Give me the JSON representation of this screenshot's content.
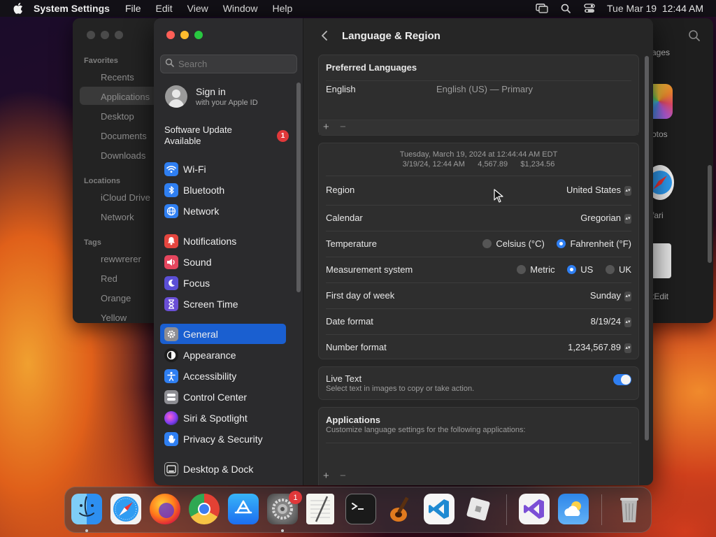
{
  "menubar": {
    "app_name": "System Settings",
    "items": [
      "File",
      "Edit",
      "View",
      "Window",
      "Help"
    ],
    "clock": "Tue Mar 19  12:44 AM"
  },
  "finder": {
    "favorites_header": "Favorites",
    "favorites": [
      "Recents",
      "Applications",
      "Desktop",
      "Documents",
      "Downloads"
    ],
    "locations_header": "Locations",
    "locations": [
      "iCloud Drive",
      "Network"
    ],
    "tags_header": "Tags",
    "tags": [
      "rewwrerer",
      "Red",
      "Orange",
      "Yellow"
    ],
    "partial_labels": [
      "ages",
      "otos",
      "fari",
      "tEdit"
    ]
  },
  "sidebar": {
    "search_placeholder": "Search",
    "signin_title": "Sign in",
    "signin_subtitle": "with your Apple ID",
    "update_label": "Software Update Available",
    "update_count": "1",
    "items": [
      {
        "label": "Wi-Fi",
        "icon": "wifi-icon",
        "color": "#2f7ff2"
      },
      {
        "label": "Bluetooth",
        "icon": "bluetooth-icon",
        "color": "#2f7ff2"
      },
      {
        "label": "Network",
        "icon": "globe-icon",
        "color": "#2f7ff2"
      },
      {
        "label": "Notifications",
        "icon": "bell-icon",
        "color": "#e5463f"
      },
      {
        "label": "Sound",
        "icon": "speaker-icon",
        "color": "#e5465e"
      },
      {
        "label": "Focus",
        "icon": "moon-icon",
        "color": "#5b4fd6"
      },
      {
        "label": "Screen Time",
        "icon": "hourglass-icon",
        "color": "#6a4fd6"
      },
      {
        "label": "General",
        "icon": "gear-icon",
        "color": "#8e8e93"
      },
      {
        "label": "Appearance",
        "icon": "appearance-icon",
        "color": "#1c1c1c"
      },
      {
        "label": "Accessibility",
        "icon": "accessibility-icon",
        "color": "#2f7ff2"
      },
      {
        "label": "Control Center",
        "icon": "control-center-icon",
        "color": "#8e8e93"
      },
      {
        "label": "Siri & Spotlight",
        "icon": "siri-icon",
        "color": "#b040d0"
      },
      {
        "label": "Privacy & Security",
        "icon": "hand-icon",
        "color": "#2f7ff2"
      },
      {
        "label": "Desktop & Dock",
        "icon": "dock-icon",
        "color": "#2b2b2b"
      }
    ],
    "selected": "General"
  },
  "content": {
    "title": "Language & Region",
    "preferred": {
      "header": "Preferred Languages",
      "language": "English",
      "language_detail": "English (US) — Primary"
    },
    "preview": {
      "line1": "Tuesday, March 19, 2024 at 12:44:44 AM EDT",
      "line2": "3/19/24, 12:44 AM      4,567.89      $1,234.56"
    },
    "region": {
      "label": "Region",
      "value": "United States"
    },
    "calendar": {
      "label": "Calendar",
      "value": "Gregorian"
    },
    "temperature": {
      "label": "Temperature",
      "options": [
        "Celsius (°C)",
        "Fahrenheit (°F)"
      ],
      "selected": "Fahrenheit (°F)"
    },
    "measurement": {
      "label": "Measurement system",
      "options": [
        "Metric",
        "US",
        "UK"
      ],
      "selected": "US"
    },
    "first_day": {
      "label": "First day of week",
      "value": "Sunday"
    },
    "date_format": {
      "label": "Date format",
      "value": "8/19/24"
    },
    "number_format": {
      "label": "Number format",
      "value": "1,234,567.89"
    },
    "live_text": {
      "title": "Live Text",
      "subtitle": "Select text in images to copy or take action.",
      "enabled": true
    },
    "applications": {
      "title": "Applications",
      "subtitle": "Customize language settings for the following applications:"
    },
    "add_symbol": "+",
    "remove_symbol": "−"
  },
  "dock": {
    "apps": [
      "Finder",
      "Safari",
      "Firefox",
      "Chrome",
      "App Store",
      "System Settings",
      "TextEdit",
      "Terminal",
      "GarageBand",
      "Visual Studio Code",
      "Roblox",
      "Visual Studio",
      "Weather",
      "Trash"
    ],
    "settings_badge": "1"
  }
}
